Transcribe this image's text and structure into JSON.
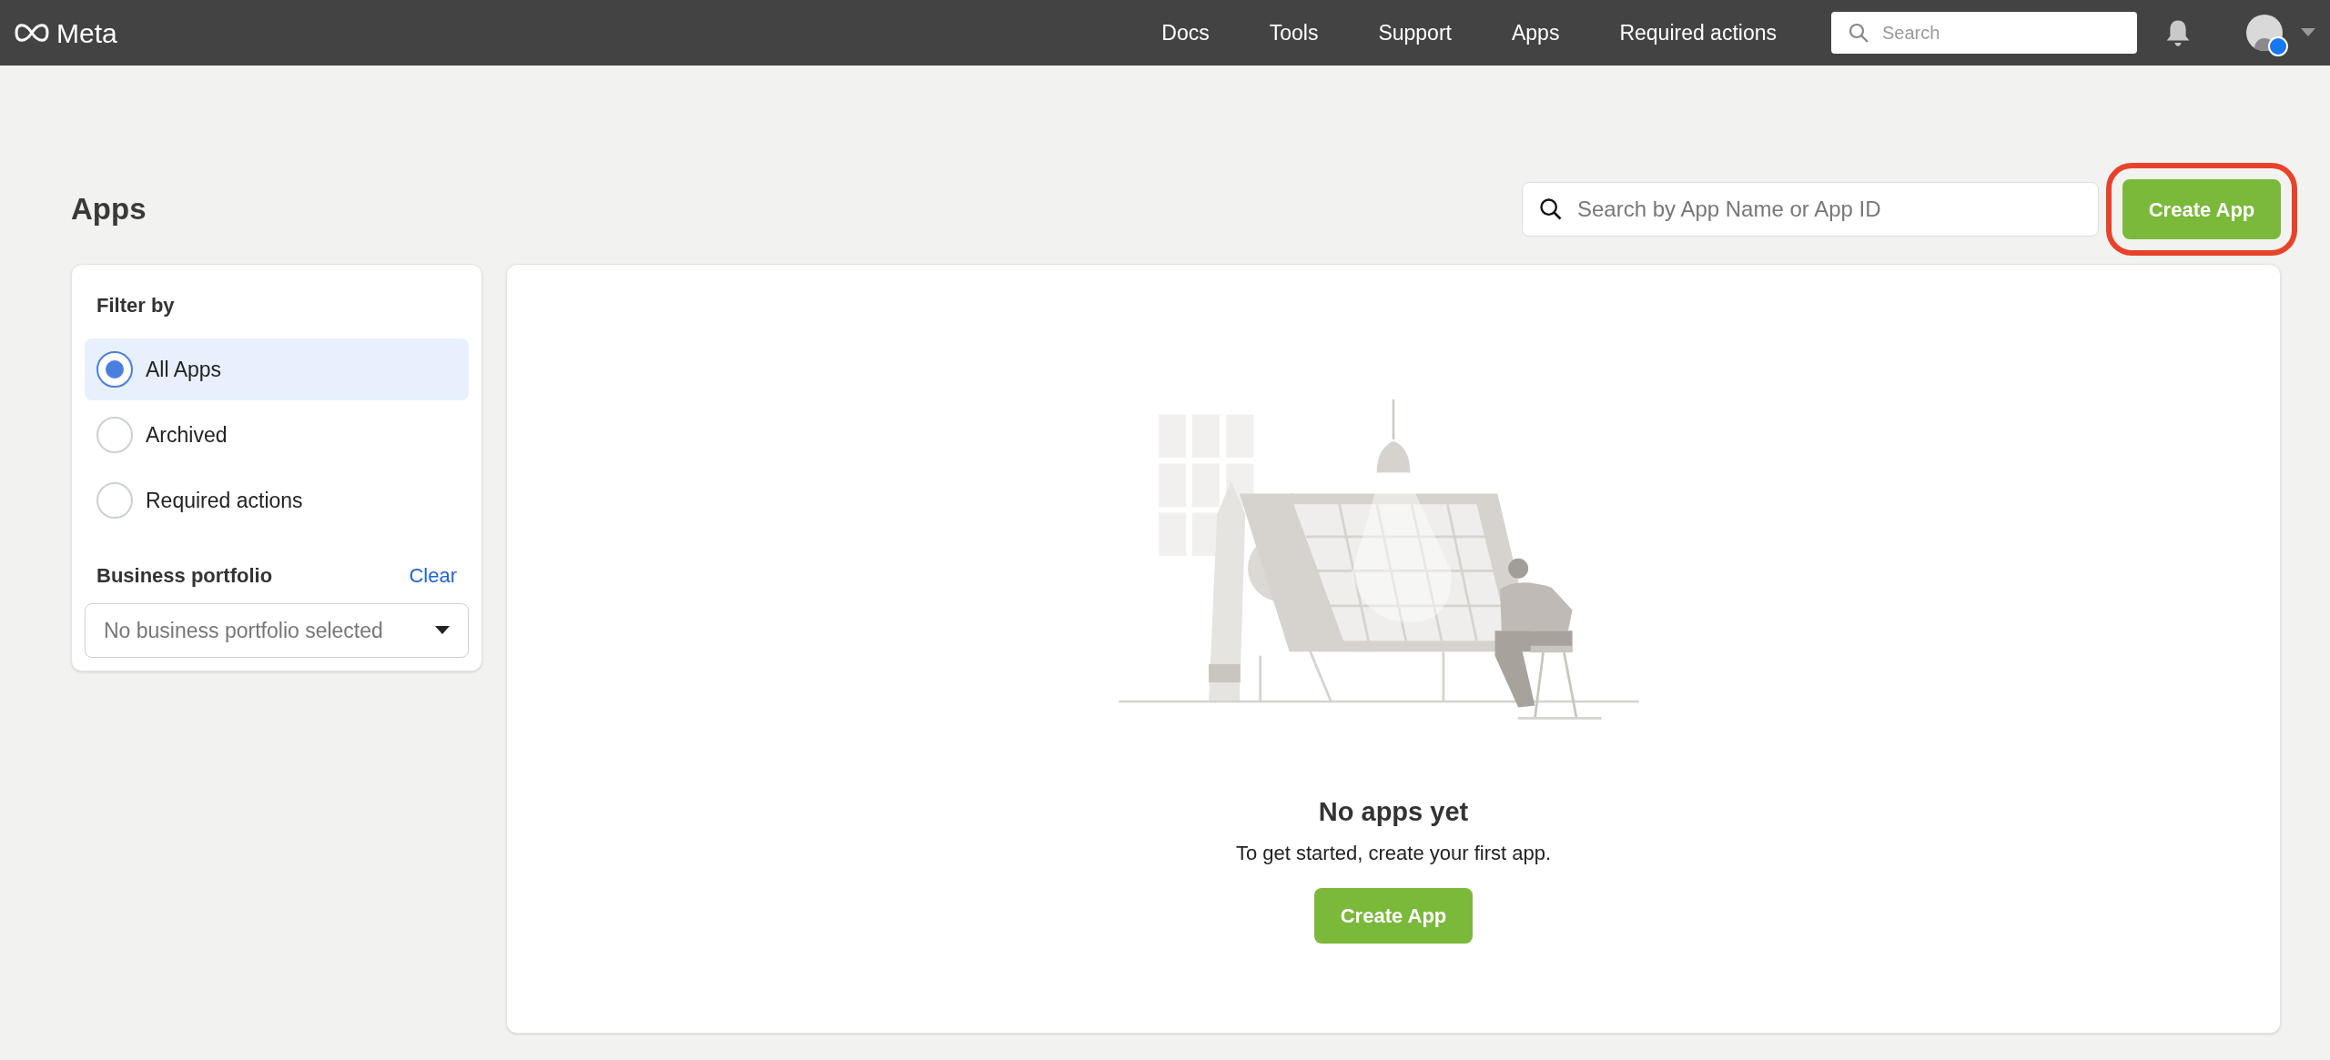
{
  "topbar": {
    "logo": "Meta",
    "nav": [
      "Docs",
      "Tools",
      "Support",
      "Apps",
      "Required actions"
    ],
    "search": {
      "placeholder": "Search"
    }
  },
  "page": {
    "title": "Apps",
    "search": {
      "placeholder": "Search by App Name or App ID"
    },
    "create_button": {
      "label": "Create App",
      "highlighted": true
    }
  },
  "filter": {
    "title": "Filter by",
    "options": [
      {
        "label": "All Apps",
        "selected": true
      },
      {
        "label": "Archived",
        "selected": false
      },
      {
        "label": "Required actions",
        "selected": false
      }
    ],
    "portfolio": {
      "label": "Business portfolio",
      "clear": "Clear",
      "placeholder": "No business portfolio selected"
    }
  },
  "empty_state": {
    "title": "No apps yet",
    "text": "To get started, create your first app.",
    "button": "Create App"
  }
}
